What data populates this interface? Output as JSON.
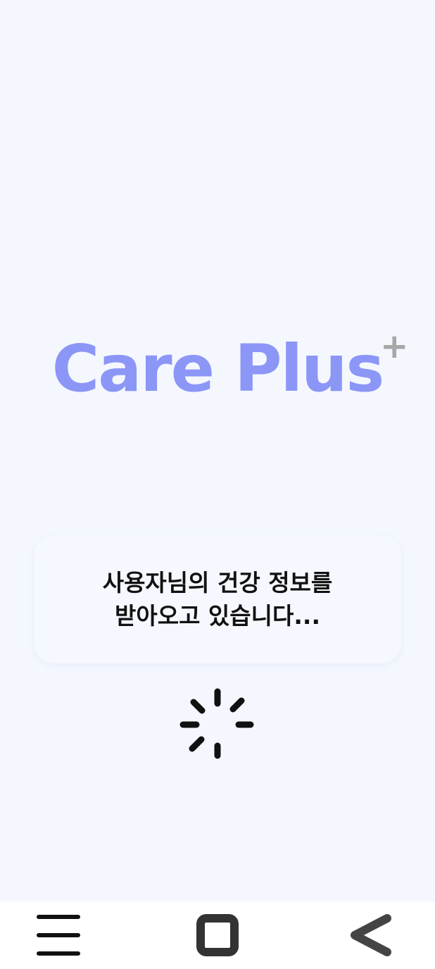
{
  "app": {
    "logo_text": "Care Plus",
    "logo_superscript": "+"
  },
  "loading": {
    "line1": "사용자님의 건강 정보를",
    "line2": "받아오고 있습니다..."
  },
  "navbar": {
    "menu_icon": "menu-icon",
    "home_icon": "square-icon",
    "back_icon": "back-chevron-icon"
  },
  "colors": {
    "background": "#f4f7fe",
    "logo": "#8b96f7",
    "logo_plus": "#a7a7a7",
    "text": "#111111",
    "navbar": "#ffffff"
  }
}
